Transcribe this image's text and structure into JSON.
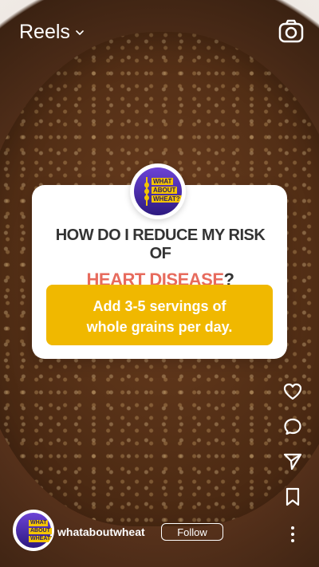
{
  "topbar": {
    "reels_label": "Reels"
  },
  "card": {
    "logo_lines": [
      "WHAT",
      "ABOUT",
      "WHEAT?"
    ],
    "question_line1": "HOW DO I REDUCE MY RISK OF",
    "question_highlight": "HEART DISEASE",
    "question_suffix": "?",
    "answer_line1": "Add 3-5 servings of",
    "answer_line2": "whole grains per day."
  },
  "profile": {
    "username": "whataboutwheat",
    "follow_label": "Follow",
    "avatar_lines": [
      "WHAT",
      "ABOUT",
      "WHEAT?"
    ]
  },
  "colors": {
    "accent_yellow": "#f0b800",
    "heart_red": "#e76b5d",
    "logo_purple": "#6c43d6"
  }
}
